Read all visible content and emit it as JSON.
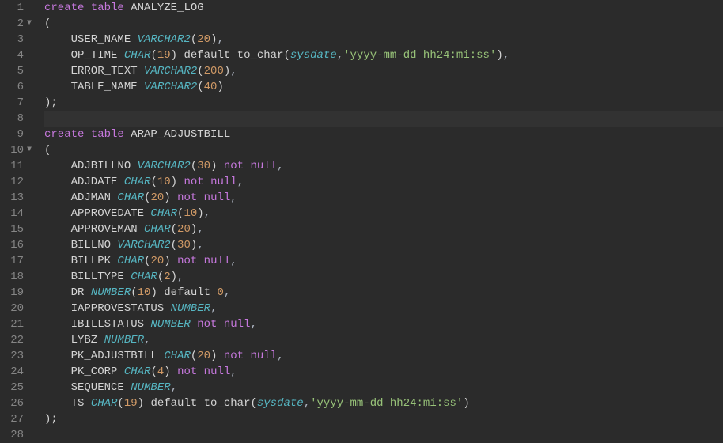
{
  "lines": [
    {
      "n": 1,
      "fold": "",
      "segs": [
        [
          "kw",
          "create table"
        ],
        [
          "ident",
          " ANALYZE_LOG"
        ]
      ]
    },
    {
      "n": 2,
      "fold": "▼",
      "segs": [
        [
          "ident",
          "("
        ]
      ]
    },
    {
      "n": 3,
      "fold": "",
      "segs": [
        [
          "ident",
          "    USER_NAME "
        ],
        [
          "type",
          "VARCHAR2"
        ],
        [
          "paren",
          "("
        ],
        [
          "num",
          "20"
        ],
        [
          "paren",
          ")"
        ],
        [
          "punct",
          ","
        ]
      ]
    },
    {
      "n": 4,
      "fold": "",
      "segs": [
        [
          "ident",
          "    OP_TIME "
        ],
        [
          "type",
          "CHAR"
        ],
        [
          "paren",
          "("
        ],
        [
          "num",
          "19"
        ],
        [
          "paren",
          ")"
        ],
        [
          "ident",
          " default to_char("
        ],
        [
          "builtin",
          "sysdate"
        ],
        [
          "punct",
          ","
        ],
        [
          "str",
          "'yyyy-mm-dd hh24:mi:ss'"
        ],
        [
          "ident",
          ")"
        ],
        [
          "punct",
          ","
        ]
      ]
    },
    {
      "n": 5,
      "fold": "",
      "segs": [
        [
          "ident",
          "    ERROR_TEXT "
        ],
        [
          "type",
          "VARCHAR2"
        ],
        [
          "paren",
          "("
        ],
        [
          "num",
          "200"
        ],
        [
          "paren",
          ")"
        ],
        [
          "punct",
          ","
        ]
      ]
    },
    {
      "n": 6,
      "fold": "",
      "segs": [
        [
          "ident",
          "    TABLE_NAME "
        ],
        [
          "type",
          "VARCHAR2"
        ],
        [
          "paren",
          "("
        ],
        [
          "num",
          "40"
        ],
        [
          "paren",
          ")"
        ]
      ]
    },
    {
      "n": 7,
      "fold": "",
      "segs": [
        [
          "ident",
          ");"
        ]
      ]
    },
    {
      "n": 8,
      "fold": "",
      "active": true,
      "segs": []
    },
    {
      "n": 9,
      "fold": "",
      "segs": [
        [
          "kw",
          "create table"
        ],
        [
          "ident",
          " ARAP_ADJUSTBILL"
        ]
      ]
    },
    {
      "n": 10,
      "fold": "▼",
      "segs": [
        [
          "ident",
          "("
        ]
      ]
    },
    {
      "n": 11,
      "fold": "",
      "segs": [
        [
          "ident",
          "    ADJBILLNO "
        ],
        [
          "type",
          "VARCHAR2"
        ],
        [
          "paren",
          "("
        ],
        [
          "num",
          "30"
        ],
        [
          "paren",
          ")"
        ],
        [
          "ident",
          " "
        ],
        [
          "notnull",
          "not null"
        ],
        [
          "punct",
          ","
        ]
      ]
    },
    {
      "n": 12,
      "fold": "",
      "segs": [
        [
          "ident",
          "    ADJDATE "
        ],
        [
          "type",
          "CHAR"
        ],
        [
          "paren",
          "("
        ],
        [
          "num",
          "10"
        ],
        [
          "paren",
          ")"
        ],
        [
          "ident",
          " "
        ],
        [
          "notnull",
          "not null"
        ],
        [
          "punct",
          ","
        ]
      ]
    },
    {
      "n": 13,
      "fold": "",
      "segs": [
        [
          "ident",
          "    ADJMAN "
        ],
        [
          "type",
          "CHAR"
        ],
        [
          "paren",
          "("
        ],
        [
          "num",
          "20"
        ],
        [
          "paren",
          ")"
        ],
        [
          "ident",
          " "
        ],
        [
          "notnull",
          "not null"
        ],
        [
          "punct",
          ","
        ]
      ]
    },
    {
      "n": 14,
      "fold": "",
      "segs": [
        [
          "ident",
          "    APPROVEDATE "
        ],
        [
          "type",
          "CHAR"
        ],
        [
          "paren",
          "("
        ],
        [
          "num",
          "10"
        ],
        [
          "paren",
          ")"
        ],
        [
          "punct",
          ","
        ]
      ]
    },
    {
      "n": 15,
      "fold": "",
      "segs": [
        [
          "ident",
          "    APPROVEMAN "
        ],
        [
          "type",
          "CHAR"
        ],
        [
          "paren",
          "("
        ],
        [
          "num",
          "20"
        ],
        [
          "paren",
          ")"
        ],
        [
          "punct",
          ","
        ]
      ]
    },
    {
      "n": 16,
      "fold": "",
      "segs": [
        [
          "ident",
          "    BILLNO "
        ],
        [
          "type",
          "VARCHAR2"
        ],
        [
          "paren",
          "("
        ],
        [
          "num",
          "30"
        ],
        [
          "paren",
          ")"
        ],
        [
          "punct",
          ","
        ]
      ]
    },
    {
      "n": 17,
      "fold": "",
      "segs": [
        [
          "ident",
          "    BILLPK "
        ],
        [
          "type",
          "CHAR"
        ],
        [
          "paren",
          "("
        ],
        [
          "num",
          "20"
        ],
        [
          "paren",
          ")"
        ],
        [
          "ident",
          " "
        ],
        [
          "notnull",
          "not null"
        ],
        [
          "punct",
          ","
        ]
      ]
    },
    {
      "n": 18,
      "fold": "",
      "segs": [
        [
          "ident",
          "    BILLTYPE "
        ],
        [
          "type",
          "CHAR"
        ],
        [
          "paren",
          "("
        ],
        [
          "num",
          "2"
        ],
        [
          "paren",
          ")"
        ],
        [
          "punct",
          ","
        ]
      ]
    },
    {
      "n": 19,
      "fold": "",
      "segs": [
        [
          "ident",
          "    DR "
        ],
        [
          "type",
          "NUMBER"
        ],
        [
          "paren",
          "("
        ],
        [
          "num",
          "10"
        ],
        [
          "paren",
          ")"
        ],
        [
          "ident",
          " default "
        ],
        [
          "num",
          "0"
        ],
        [
          "punct",
          ","
        ]
      ]
    },
    {
      "n": 20,
      "fold": "",
      "segs": [
        [
          "ident",
          "    IAPPROVESTATUS "
        ],
        [
          "type",
          "NUMBER"
        ],
        [
          "punct",
          ","
        ]
      ]
    },
    {
      "n": 21,
      "fold": "",
      "segs": [
        [
          "ident",
          "    IBILLSTATUS "
        ],
        [
          "type",
          "NUMBER"
        ],
        [
          "ident",
          " "
        ],
        [
          "notnull",
          "not null"
        ],
        [
          "punct",
          ","
        ]
      ]
    },
    {
      "n": 22,
      "fold": "",
      "segs": [
        [
          "ident",
          "    LYBZ "
        ],
        [
          "type",
          "NUMBER"
        ],
        [
          "punct",
          ","
        ]
      ]
    },
    {
      "n": 23,
      "fold": "",
      "segs": [
        [
          "ident",
          "    PK_ADJUSTBILL "
        ],
        [
          "type",
          "CHAR"
        ],
        [
          "paren",
          "("
        ],
        [
          "num",
          "20"
        ],
        [
          "paren",
          ")"
        ],
        [
          "ident",
          " "
        ],
        [
          "notnull",
          "not null"
        ],
        [
          "punct",
          ","
        ]
      ]
    },
    {
      "n": 24,
      "fold": "",
      "segs": [
        [
          "ident",
          "    PK_CORP "
        ],
        [
          "type",
          "CHAR"
        ],
        [
          "paren",
          "("
        ],
        [
          "num",
          "4"
        ],
        [
          "paren",
          ")"
        ],
        [
          "ident",
          " "
        ],
        [
          "notnull",
          "not null"
        ],
        [
          "punct",
          ","
        ]
      ]
    },
    {
      "n": 25,
      "fold": "",
      "segs": [
        [
          "ident",
          "    SEQUENCE "
        ],
        [
          "type",
          "NUMBER"
        ],
        [
          "punct",
          ","
        ]
      ]
    },
    {
      "n": 26,
      "fold": "",
      "segs": [
        [
          "ident",
          "    TS "
        ],
        [
          "type",
          "CHAR"
        ],
        [
          "paren",
          "("
        ],
        [
          "num",
          "19"
        ],
        [
          "paren",
          ")"
        ],
        [
          "ident",
          " default to_char("
        ],
        [
          "builtin",
          "sysdate"
        ],
        [
          "punct",
          ","
        ],
        [
          "str",
          "'yyyy-mm-dd hh24:mi:ss'"
        ],
        [
          "ident",
          ")"
        ]
      ]
    },
    {
      "n": 27,
      "fold": "",
      "segs": [
        [
          "ident",
          ");"
        ]
      ]
    },
    {
      "n": 28,
      "fold": "",
      "segs": []
    }
  ]
}
